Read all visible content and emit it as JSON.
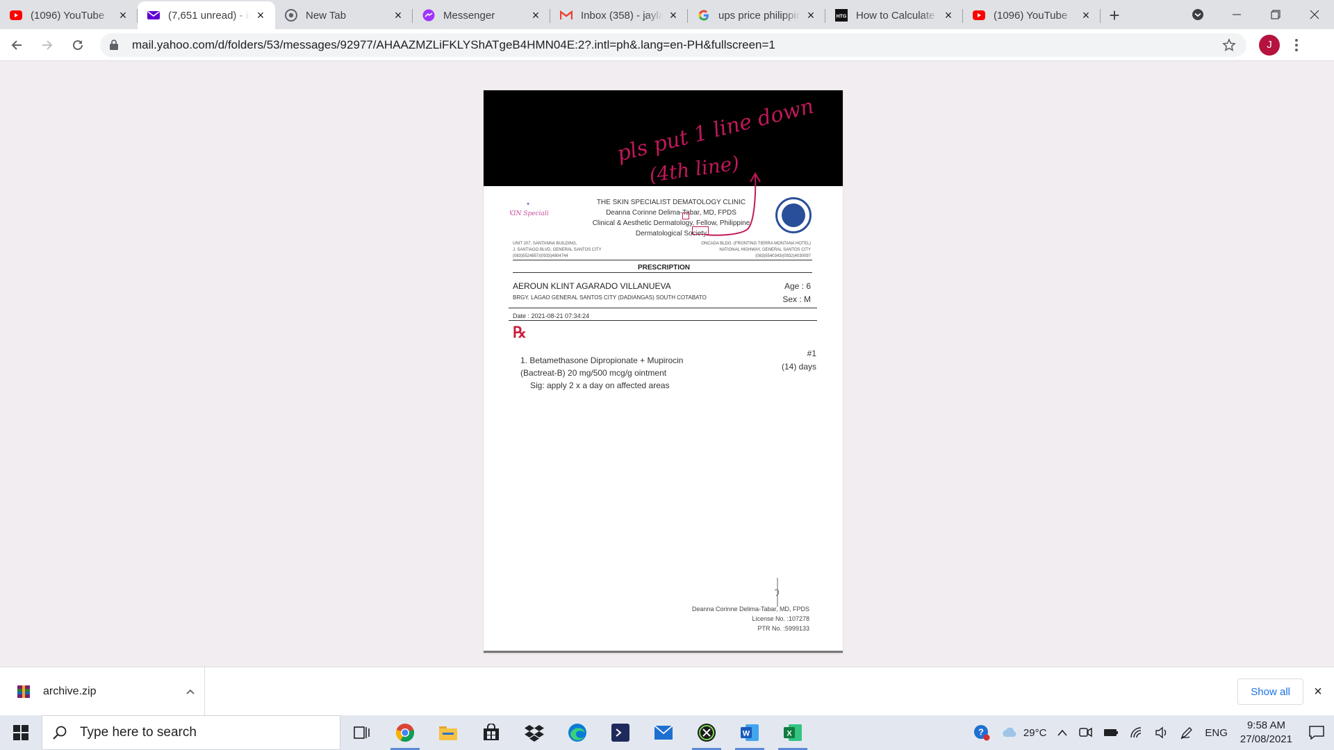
{
  "browser": {
    "tabs": [
      {
        "label": "(1096) YouTube",
        "icon": "youtube-icon",
        "active": false
      },
      {
        "label": "(7,651 unread) - in",
        "icon": "yahoo-mail-icon",
        "active": true
      },
      {
        "label": "New Tab",
        "icon": "chrome-icon",
        "active": false
      },
      {
        "label": "Messenger",
        "icon": "messenger-icon",
        "active": false
      },
      {
        "label": "Inbox (358) - jayla",
        "icon": "gmail-icon",
        "active": false
      },
      {
        "label": "ups price philippin",
        "icon": "google-icon",
        "active": false
      },
      {
        "label": "How to Calculate",
        "icon": "htg-icon",
        "active": false
      },
      {
        "label": "(1096) YouTube",
        "icon": "youtube-icon",
        "active": false
      }
    ],
    "url": "mail.yahoo.com/d/folders/53/messages/92977/AHAAZMZLiFKLYShATgeB4HMN04E:2?.intl=ph&.lang=en-PH&fullscreen=1",
    "avatar_letter": "J",
    "htg_badge": "HTG"
  },
  "handwritten_note": {
    "line1": "pls put 1 line down",
    "line2": "(4th line)"
  },
  "prescription": {
    "clinic_lines": [
      "THE SKIN SPECIALIST DEMATOLOGY CLINIC",
      "Deanna Corinne Delima-Tabar, MD, FPDS",
      "Clinical & Aesthetic Dermatology, Fellow, Philippine",
      "Dermatological Society"
    ],
    "logo_text": "SKIN Specialist",
    "address_left": [
      "UNIT 207, SANTANNA BUILDING,",
      "J. SANTIAGO BLVD, GENERAL SANTOS CITY",
      "(083)5524857/(0933)4804744"
    ],
    "address_right": [
      "ONCADA BLDG. (FRONTING TIERRA MONTANA HOTEL)",
      "NATIONAL HIGHWAY, GENERAL SANTOS CITY",
      "(083)5540343/(0932)4030097"
    ],
    "title": "PRESCRIPTION",
    "patient_name": "AEROUN KLINT AGARADO VILLANUEVA",
    "patient_address": "BRGY. LAGAO GENERAL SANTOS CITY (DADIANGAS) SOUTH COTABATO",
    "age": "Age : 6",
    "sex": "Sex : M",
    "date": "Date : 2021-08-21 07:34:24",
    "rx_symbol": "℞",
    "medication": {
      "line1": "1. Betamethasone Dipropionate + Mupirocin",
      "line2": "(Bactreat-B) 20 mg/500 mcg/g ointment",
      "sig": "Sig:   apply 2 x a day on affected areas",
      "quantity": "#1",
      "duration": "(14) days"
    },
    "doctor": {
      "name": "Deanna Corinne Delima-Tabar, MD, FPDS",
      "license": "License No. :107278",
      "ptr": "PTR No. :5999133"
    }
  },
  "downloads": {
    "file_name": "archive.zip",
    "show_all": "Show all"
  },
  "taskbar": {
    "search_placeholder": "Type here to search",
    "weather": "29°C",
    "language": "ENG",
    "time": "9:58 AM",
    "date": "27/08/2021"
  },
  "colors": {
    "accent_yahoo": "#6001d2",
    "handwriting": "#c2185b",
    "rx_red": "#c81e3c",
    "avatar": "#b5123e"
  }
}
